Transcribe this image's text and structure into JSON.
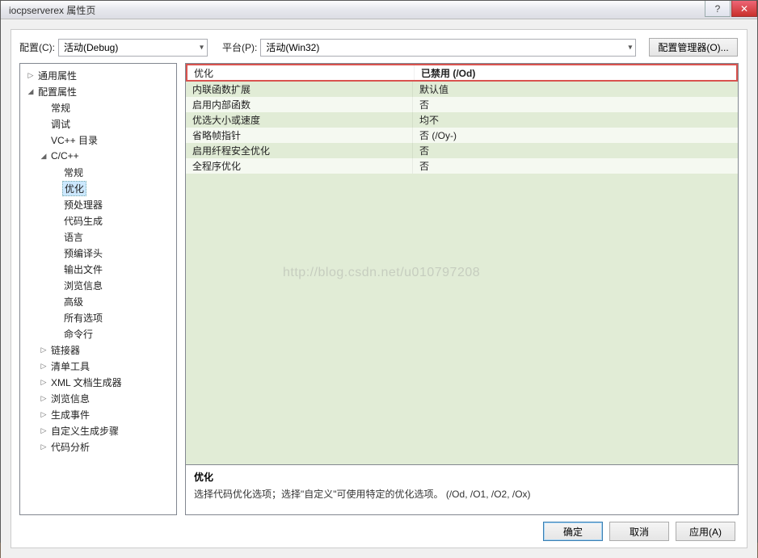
{
  "window": {
    "title": "iocpserverex 属性页"
  },
  "toprow": {
    "config_label": "配置(C):",
    "config_value": "活动(Debug)",
    "platform_label": "平台(P):",
    "platform_value": "活动(Win32)",
    "manager_button": "配置管理器(O)..."
  },
  "tree": [
    {
      "label": "通用属性",
      "depth": 0,
      "arrow": "▷"
    },
    {
      "label": "配置属性",
      "depth": 0,
      "arrow": "◢"
    },
    {
      "label": "常规",
      "depth": 1,
      "arrow": ""
    },
    {
      "label": "调试",
      "depth": 1,
      "arrow": ""
    },
    {
      "label": "VC++ 目录",
      "depth": 1,
      "arrow": ""
    },
    {
      "label": "C/C++",
      "depth": 1,
      "arrow": "◢"
    },
    {
      "label": "常规",
      "depth": 2,
      "arrow": ""
    },
    {
      "label": "优化",
      "depth": 2,
      "arrow": "",
      "selected": true
    },
    {
      "label": "预处理器",
      "depth": 2,
      "arrow": ""
    },
    {
      "label": "代码生成",
      "depth": 2,
      "arrow": ""
    },
    {
      "label": "语言",
      "depth": 2,
      "arrow": ""
    },
    {
      "label": "预编译头",
      "depth": 2,
      "arrow": ""
    },
    {
      "label": "输出文件",
      "depth": 2,
      "arrow": ""
    },
    {
      "label": "浏览信息",
      "depth": 2,
      "arrow": ""
    },
    {
      "label": "高级",
      "depth": 2,
      "arrow": ""
    },
    {
      "label": "所有选项",
      "depth": 2,
      "arrow": ""
    },
    {
      "label": "命令行",
      "depth": 2,
      "arrow": ""
    },
    {
      "label": "链接器",
      "depth": 1,
      "arrow": "▷"
    },
    {
      "label": "清单工具",
      "depth": 1,
      "arrow": "▷"
    },
    {
      "label": "XML 文档生成器",
      "depth": 1,
      "arrow": "▷"
    },
    {
      "label": "浏览信息",
      "depth": 1,
      "arrow": "▷"
    },
    {
      "label": "生成事件",
      "depth": 1,
      "arrow": "▷"
    },
    {
      "label": "自定义生成步骤",
      "depth": 1,
      "arrow": "▷"
    },
    {
      "label": "代码分析",
      "depth": 1,
      "arrow": "▷"
    }
  ],
  "grid": [
    {
      "name": "优化",
      "value": "已禁用 (/Od)",
      "highlight": true
    },
    {
      "name": "内联函数扩展",
      "value": "默认值"
    },
    {
      "name": "启用内部函数",
      "value": "否"
    },
    {
      "name": "优选大小或速度",
      "value": "均不"
    },
    {
      "name": "省略帧指针",
      "value": "否 (/Oy-)"
    },
    {
      "name": "启用纤程安全优化",
      "value": "否"
    },
    {
      "name": "全程序优化",
      "value": "否"
    }
  ],
  "desc": {
    "title": "优化",
    "text": "选择代码优化选项；选择\"自定义\"可使用特定的优化选项。     (/Od, /O1, /O2, /Ox)"
  },
  "buttons": {
    "ok": "确定",
    "cancel": "取消",
    "apply": "应用(A)"
  },
  "watermark": "http://blog.csdn.net/u010797208"
}
